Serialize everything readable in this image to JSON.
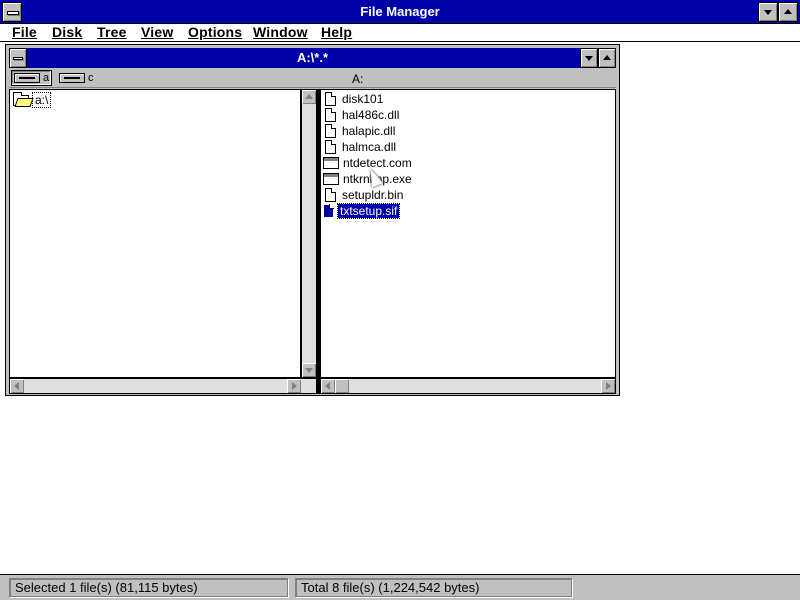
{
  "window": {
    "title": "File Manager"
  },
  "menu": {
    "items": [
      {
        "label": "File"
      },
      {
        "label": "Disk"
      },
      {
        "label": "Tree"
      },
      {
        "label": "View"
      },
      {
        "label": "Options"
      },
      {
        "label": "Window"
      },
      {
        "label": "Help"
      }
    ]
  },
  "child_window": {
    "title": "A:\\*.*",
    "current_path": "A:",
    "drives": [
      {
        "label": "a",
        "selected": true
      },
      {
        "label": "c",
        "selected": false
      }
    ]
  },
  "tree": {
    "items": [
      {
        "label": "a:\\"
      }
    ]
  },
  "files": {
    "items": [
      {
        "name": "disk101",
        "icon": "document-icon"
      },
      {
        "name": "hal486c.dll",
        "icon": "document-icon"
      },
      {
        "name": "halapic.dll",
        "icon": "document-icon"
      },
      {
        "name": "halmca.dll",
        "icon": "document-icon"
      },
      {
        "name": "ntdetect.com",
        "icon": "program-icon"
      },
      {
        "name": "ntkrnlmp.exe",
        "icon": "program-icon"
      },
      {
        "name": "setupldr.bin",
        "icon": "document-icon"
      },
      {
        "name": "txtsetup.sif",
        "icon": "document-icon",
        "selected": true
      }
    ]
  },
  "status": {
    "selected": "Selected 1 file(s) (81,115 bytes)",
    "total": "Total 8 file(s) (1,224,542 bytes)"
  },
  "colors": {
    "titlebar": "#0000a8",
    "face": "#c0c0c0",
    "selection": "#0000a8"
  }
}
